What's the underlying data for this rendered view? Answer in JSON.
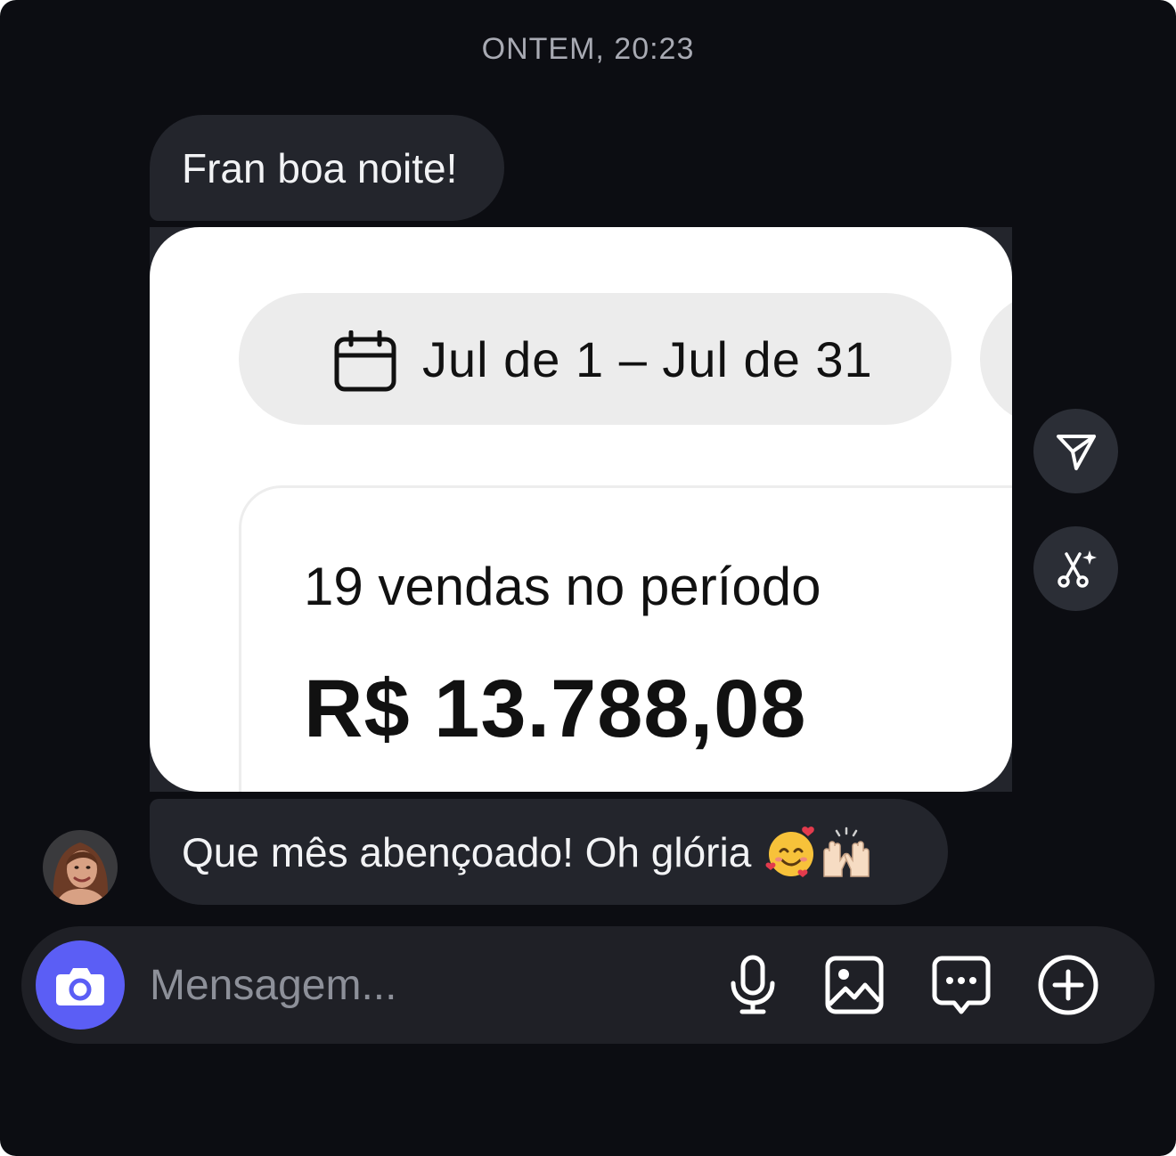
{
  "chat": {
    "timestamp": "ONTEM, 20:23",
    "messages": [
      {
        "text": "Fran boa noite!"
      },
      {
        "image": {
          "date_range": "Jul de 1 – Jul de 31",
          "sales_count": "19 vendas no período",
          "sales_total": "R$ 13.788,08"
        }
      },
      {
        "text": "Que mês abençoado! Oh glória",
        "emojis": [
          "smiling-face-with-hearts",
          "raising-hands"
        ]
      }
    ],
    "image_actions": [
      "send-icon",
      "edit-icon"
    ]
  },
  "composer": {
    "placeholder": "Mensagem...",
    "value": "",
    "icons": [
      "camera-icon",
      "microphone-icon",
      "gallery-icon",
      "sticker-chat-icon",
      "plus-icon"
    ]
  },
  "colors": {
    "background": "#0c0d12",
    "bubble": "#23252c",
    "camera_button": "#5b5ef5",
    "timestamp": "#a8aab3",
    "placeholder": "#8d9099"
  }
}
